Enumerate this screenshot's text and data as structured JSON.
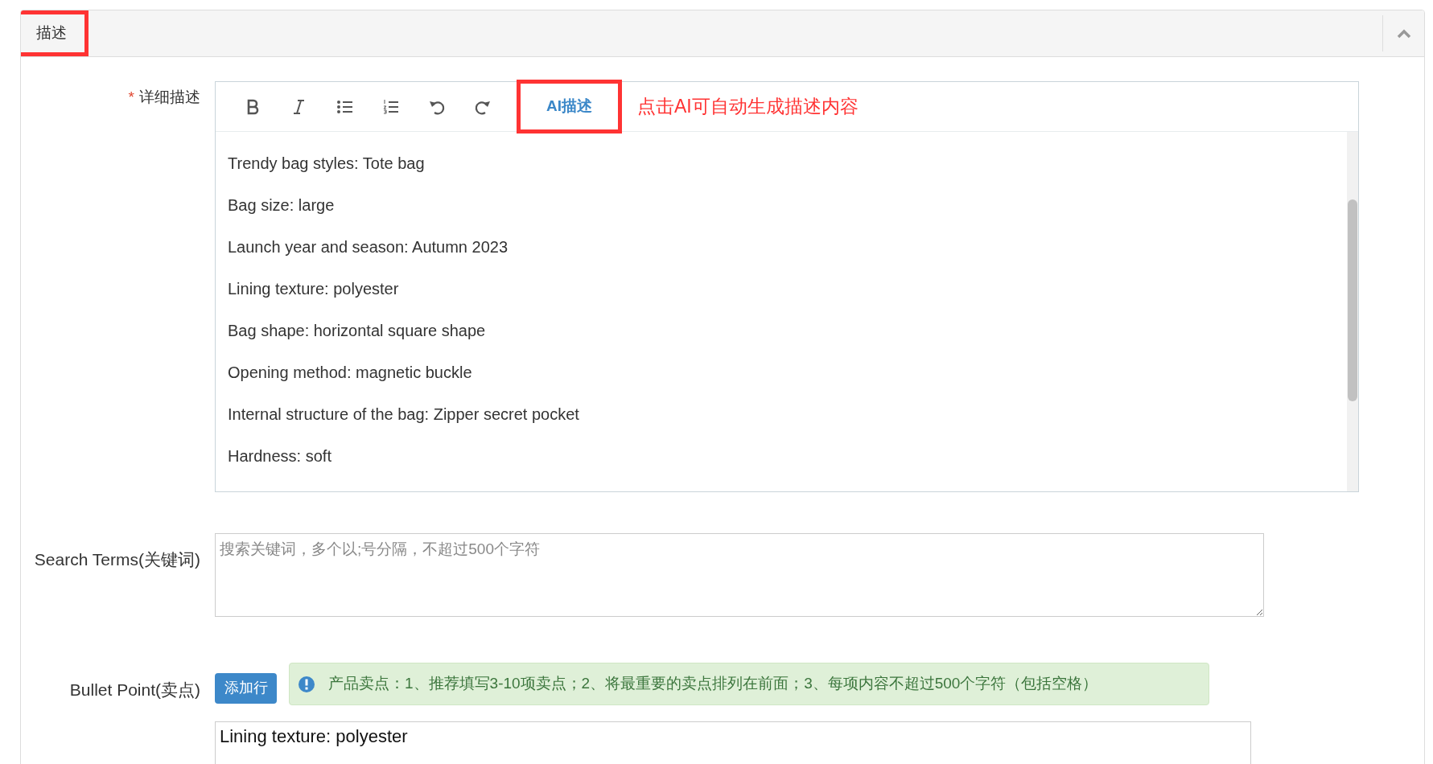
{
  "section": {
    "title": "描述",
    "highlighted": true,
    "expanded": true
  },
  "description": {
    "label": "详细描述",
    "required_marker": "*",
    "ai_button": {
      "label": "AI描述",
      "highlighted": true
    },
    "hint": "点击AI可自动生成描述内容",
    "lines": [
      "Trendy bag styles: Tote bag",
      "Bag size: large",
      "Launch year and season: Autumn 2023",
      "Lining texture: polyester",
      "Bag shape: horizontal square shape",
      "Opening method: magnetic buckle",
      "Internal structure of the bag: Zipper secret pocket",
      "Hardness: soft"
    ]
  },
  "search_terms": {
    "label": "Search Terms(关键词)",
    "placeholder": "搜索关键词，多个以;号分隔，不超过500个字符"
  },
  "bullet_point": {
    "label": "Bullet Point(卖点)",
    "add_button": "添加行",
    "notice": "产品卖点：1、推荐填写3-10项卖点；2、将最重要的卖点排列在前面；3、每项内容不超过500个字符（包括空格）",
    "items": [
      "Lining texture: polyester"
    ]
  }
}
